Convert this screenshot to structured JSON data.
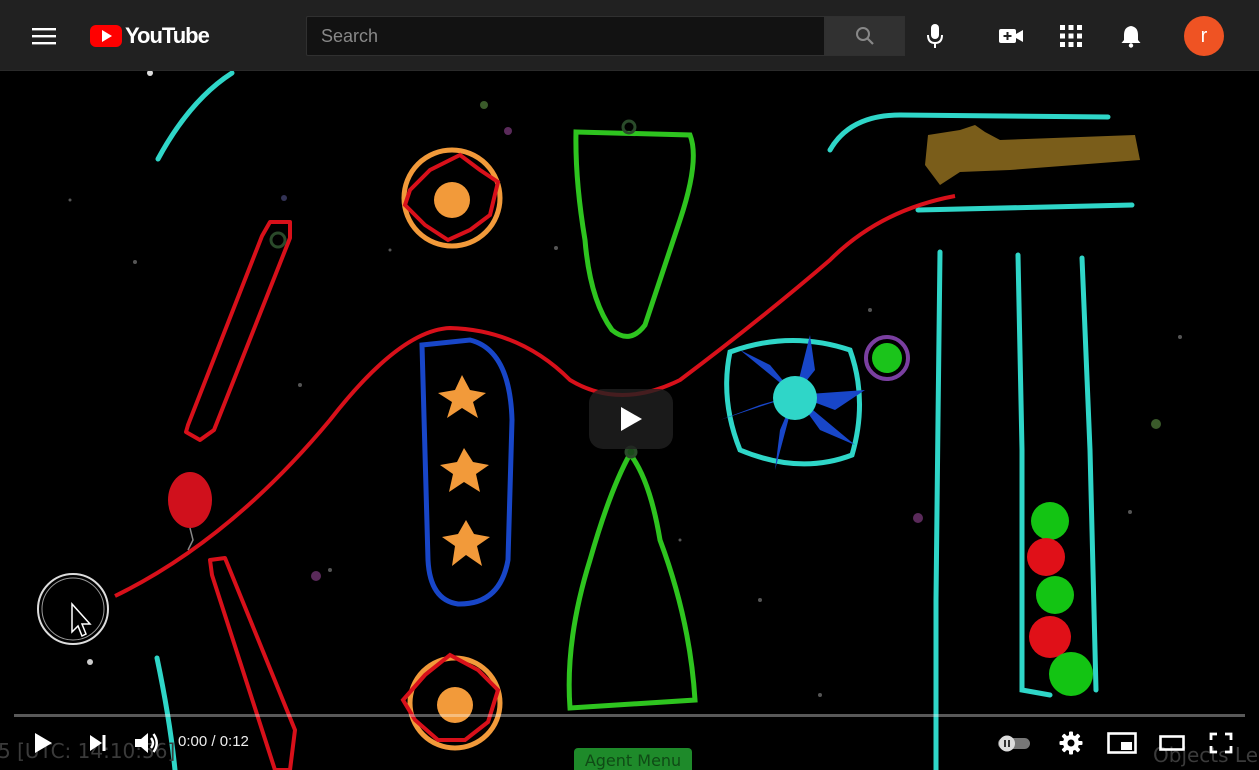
{
  "masthead": {
    "logo_text": "YouTube",
    "search_placeholder": "Search",
    "avatar_letter": "r",
    "brand_red": "#ff0000",
    "avatar_color": "#ef5323"
  },
  "video": {
    "overlay_left": "5 [UTC: 14:10:56]",
    "overlay_right": "Objects Le",
    "agent_menu": "Agent Menu"
  },
  "player": {
    "time_display": "0:00 / 0:12",
    "progress_fraction": 0,
    "icons": [
      "play-icon",
      "next-icon",
      "volume-icon",
      "autoplay-toggle-icon",
      "settings-icon",
      "miniplayer-icon",
      "theater-icon",
      "fullscreen-icon"
    ]
  }
}
